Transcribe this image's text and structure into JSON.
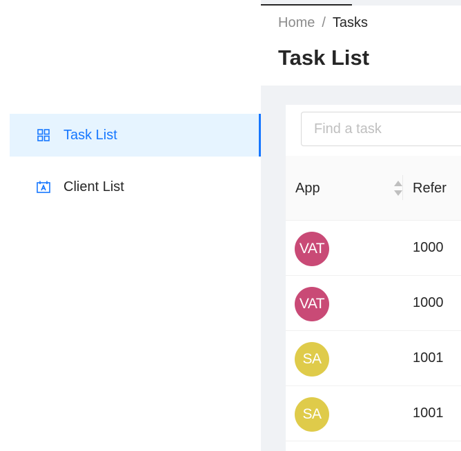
{
  "sidebar": {
    "items": [
      {
        "label": "Task List",
        "icon": "grid-icon",
        "active": true
      },
      {
        "label": "Client List",
        "icon": "calendar-icon",
        "active": false
      }
    ]
  },
  "breadcrumb": {
    "home": "Home",
    "separator": "/",
    "current": "Tasks"
  },
  "page": {
    "title": "Task List"
  },
  "search": {
    "placeholder": "Find a task"
  },
  "table": {
    "columns": [
      {
        "label": "App",
        "sortable": true
      },
      {
        "label": "Refer"
      }
    ],
    "rows": [
      {
        "app": "VAT",
        "ref": "1000"
      },
      {
        "app": "VAT",
        "ref": "1000"
      },
      {
        "app": "SA",
        "ref": "1001"
      },
      {
        "app": "SA",
        "ref": "1001"
      }
    ]
  },
  "colors": {
    "accent": "#1677ff",
    "vat": "#c94a76",
    "sa": "#dfcb4a"
  }
}
